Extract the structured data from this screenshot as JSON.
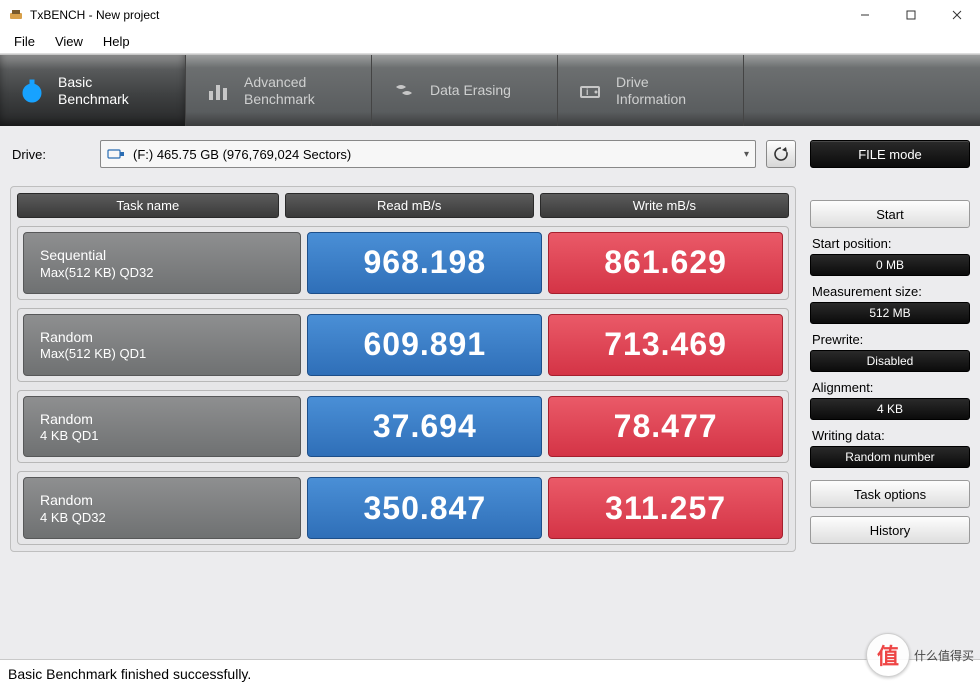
{
  "window": {
    "title": "TxBENCH - New project"
  },
  "menu": {
    "file": "File",
    "view": "View",
    "help": "Help"
  },
  "tabs": {
    "basic": "Basic\nBenchmark",
    "advanced": "Advanced\nBenchmark",
    "erasing": "Data Erasing",
    "drive": "Drive\nInformation"
  },
  "drive": {
    "label": "Drive:",
    "value": "(F:)  465.75 GB (976,769,024 Sectors)"
  },
  "file_mode": "FILE mode",
  "headers": {
    "task": "Task name",
    "read": "Read mB/s",
    "write": "Write mB/s"
  },
  "rows": [
    {
      "name1": "Sequential",
      "name2": "Max(512 KB) QD32",
      "read": "968.198",
      "write": "861.629"
    },
    {
      "name1": "Random",
      "name2": "Max(512 KB) QD1",
      "read": "609.891",
      "write": "713.469"
    },
    {
      "name1": "Random",
      "name2": "4 KB QD1",
      "read": "37.694",
      "write": "78.477"
    },
    {
      "name1": "Random",
      "name2": "4 KB QD32",
      "read": "350.847",
      "write": "311.257"
    }
  ],
  "side": {
    "start": "Start",
    "start_pos_label": "Start position:",
    "start_pos": "0 MB",
    "meas_label": "Measurement size:",
    "meas": "512 MB",
    "prewrite_label": "Prewrite:",
    "prewrite": "Disabled",
    "align_label": "Alignment:",
    "align": "4 KB",
    "writing_label": "Writing data:",
    "writing": "Random number",
    "task_options": "Task options",
    "history": "History"
  },
  "status": "Basic Benchmark finished successfully.",
  "watermark": {
    "char": "值",
    "text": "什么值得买"
  }
}
